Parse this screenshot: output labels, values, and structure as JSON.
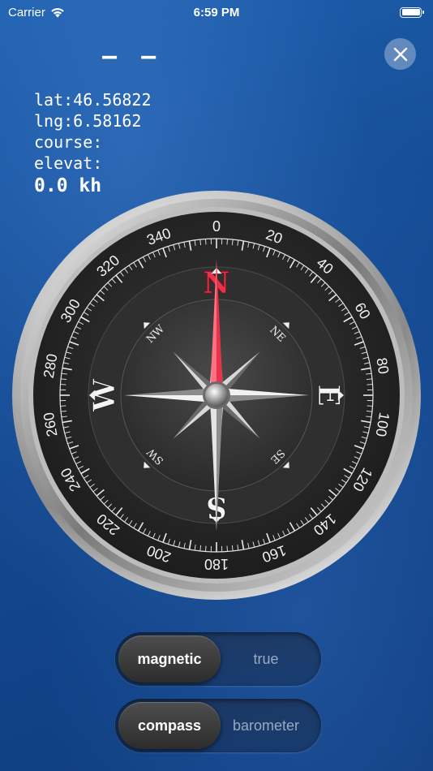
{
  "status_bar": {
    "carrier": "Carrier",
    "time": "6:59 PM",
    "wifi_icon": "wifi-icon",
    "battery_icon": "battery-icon",
    "battery_level": 1.0
  },
  "heading_readout": "— —",
  "close_icon": "close-icon",
  "info": {
    "lat": "lat:46.56822",
    "lng": "lng:6.58162",
    "course": "course:",
    "elevation": "elevat:",
    "speed": "0.0 kh"
  },
  "compass": {
    "heading_deg": 0,
    "cardinals": [
      "N",
      "E",
      "S",
      "W"
    ],
    "intercardinals": [
      "NE",
      "SE",
      "SW",
      "NW"
    ],
    "degree_labels": [
      "0",
      "20",
      "40",
      "60",
      "80",
      "100",
      "120",
      "140",
      "160",
      "180",
      "200",
      "220",
      "240",
      "260",
      "280",
      "300",
      "320",
      "340"
    ],
    "needle_north_color": "#e8334a",
    "needle_south_color": "#c9c9c9"
  },
  "toggles": {
    "north_mode": {
      "selected": "magnetic",
      "other": "true"
    },
    "display_mode": {
      "selected": "compass",
      "other": "barometer"
    }
  }
}
